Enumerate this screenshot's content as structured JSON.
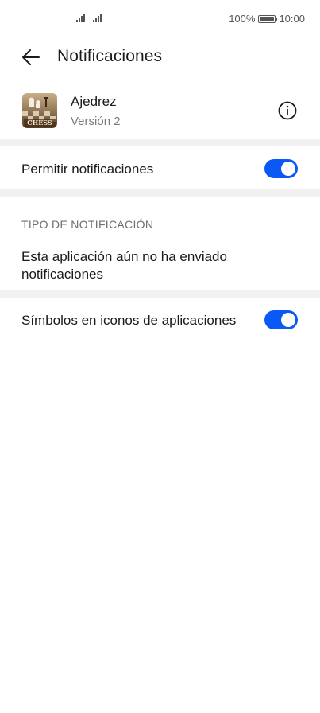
{
  "status_bar": {
    "battery_text": "100%",
    "time": "10:00",
    "icons": [
      "signal-icon",
      "signal-icon",
      "battery-icon"
    ]
  },
  "header": {
    "back_icon": "arrow-left-icon",
    "title": "Notificaciones"
  },
  "app": {
    "name": "Ajedrez",
    "version": "Versión 2",
    "icon": "chess-app-icon",
    "info_icon": "info-circle-icon"
  },
  "settings": {
    "allow_notifications": {
      "label": "Permitir notificaciones",
      "enabled": true
    },
    "notification_type_header": "TIPO DE NOTIFICACIÓN",
    "empty_message": "Esta aplicación aún no ha enviado notificaciones",
    "badge_icons": {
      "label": "Símbolos en iconos de aplicaciones",
      "enabled": true
    }
  },
  "colors": {
    "accent": "#0a59f7",
    "divider": "#f1f1f1",
    "secondary_text": "#7a7a7a"
  }
}
